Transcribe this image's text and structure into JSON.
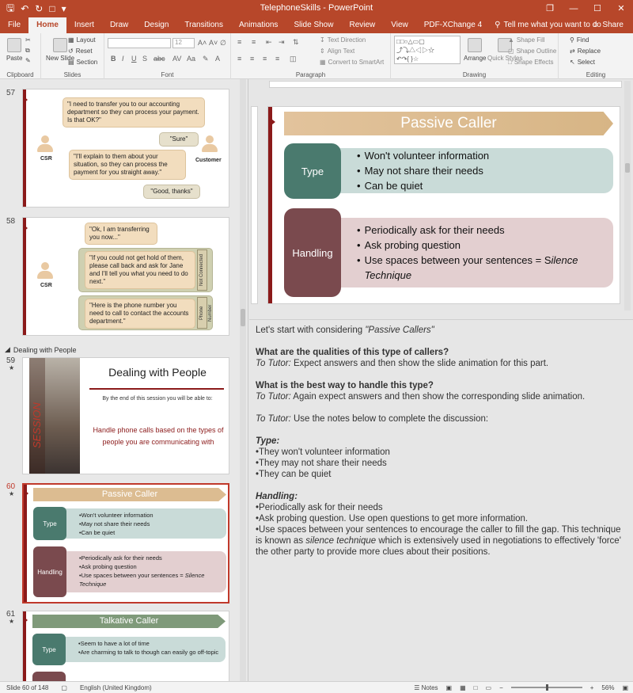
{
  "titlebar": {
    "title": "TelephoneSkills - PowerPoint",
    "save_icon": "save-icon",
    "min": "—",
    "max": "☐",
    "close": "✕",
    "restore": "❐"
  },
  "tabs": [
    "File",
    "Home",
    "Insert",
    "Draw",
    "Design",
    "Transitions",
    "Animations",
    "Slide Show",
    "Review",
    "View",
    "PDF-XChange 4"
  ],
  "tellme": "Tell me what you want to do",
  "share": "Share",
  "ribbon": {
    "clipboard": {
      "label": "Clipboard",
      "paste": "Paste"
    },
    "slides": {
      "label": "Slides",
      "new_slide": "New Slide",
      "layout": "Layout",
      "reset": "Reset",
      "section": "Section"
    },
    "font": {
      "label": "Font",
      "size": "12"
    },
    "paragraph": {
      "label": "Paragraph",
      "text_direction": "Text Direction",
      "align_text": "Align Text",
      "convert": "Convert to SmartArt"
    },
    "drawing": {
      "label": "Drawing",
      "arrange": "Arrange",
      "quick_styles": "Quick Styles",
      "fill": "Shape Fill",
      "outline": "Shape Outline",
      "effects": "Shape Effects"
    },
    "editing": {
      "label": "Editing",
      "find": "Find",
      "replace": "Replace",
      "select": "Select"
    }
  },
  "thumbs": {
    "s57": {
      "num": "57",
      "b1": "\"I need to transfer you to our accounting department so they can process your payment. Is that OK?\"",
      "b2": "\"Sure\"",
      "b3": "\"I'll explain to them about your situation, so they can process the payment for you straight away.\"",
      "b4": "\"Good, thanks\"",
      "csr": "CSR",
      "customer": "Customer"
    },
    "s58": {
      "num": "58",
      "b1": "\"Ok, I am transferring you now...\"",
      "b2": "\"If you could not get hold of them, please call back and ask for Jane and I'll tell you what you need to do next.\"",
      "b3": "\"Here is the phone number you need to call to contact the accounts department.\"",
      "v1": "Not Connected",
      "v2": "Phone Number",
      "csr": "CSR"
    },
    "section": "Dealing with People",
    "s59": {
      "num": "59",
      "title": "Dealing with People",
      "session": "SESSION",
      "sub": "By the end of this session you will be able to:",
      "goal": "Handle phone calls based on the types of people you are communicating with"
    },
    "s60": {
      "num": "60",
      "title": "Passive Caller",
      "type": "Type",
      "handling": "Handling",
      "type_items": [
        "Won't volunteer information",
        "May not share their needs",
        "Can be quiet"
      ],
      "handling_items": [
        "Periodically ask for their needs",
        "Ask probing question"
      ],
      "handling_last": "Use spaces between your sentences = ",
      "handling_last_italic": "Silence Technique"
    },
    "s61": {
      "num": "61",
      "title": "Talkative Caller",
      "type": "Type",
      "type_items": [
        "Seem to have a lot of time",
        "Are charming to talk to though can easily go off-topic"
      ]
    }
  },
  "slide": {
    "title": "Passive Caller",
    "type": "Type",
    "handling": "Handling",
    "type_items": [
      "Won't volunteer information",
      "May not share their needs",
      "Can be quiet"
    ],
    "handling_items": [
      "Periodically ask for their needs",
      "Ask probing question"
    ],
    "handling_last": "Use spaces between your sentences = S",
    "handling_last_italic": "ilence Technique"
  },
  "notes": {
    "intro": "Let's start with considering ",
    "intro_italic": "\"Passive Callers\"",
    "q1": "What are the qualities of this type of callers?",
    "tutor": "To Tutor:",
    "t1": " Expect answers and then show the slide animation for this part.",
    "q2": "What is the best way to handle this type?",
    "t2": " Again expect answers and then show the corresponding slide animation.",
    "t3": " Use the notes below to complete the discussion:",
    "type_h": "Type:",
    "type_items": [
      "•They won't volunteer information",
      "•They may not share their needs",
      "•They can be quiet"
    ],
    "handling_h": "Handling:",
    "h1": "•Periodically ask for their needs",
    "h2": "•Ask probing question. Use open questions to get more information.",
    "h3a": "•Use spaces between your sentences to encourage the caller to fill the gap. This technique is known as ",
    "h3i": "silence technique",
    "h3b": " which is extensively used in negotiations to effectively 'force' the other party to provide more clues about their positions."
  },
  "status": {
    "slide": "Slide 60 of 148",
    "lang": "English (United Kingdom)",
    "notes": "Notes",
    "zoom": "56%"
  },
  "colors": {
    "accent": "#b7472a",
    "type_box": "#4a7a6e",
    "handling_box": "#7a4a4e",
    "type_bg": "#c9dbd8",
    "handling_bg": "#e3cfd0",
    "title_bar": "#d7b585",
    "talkative_bar": "#7f9a7a"
  }
}
